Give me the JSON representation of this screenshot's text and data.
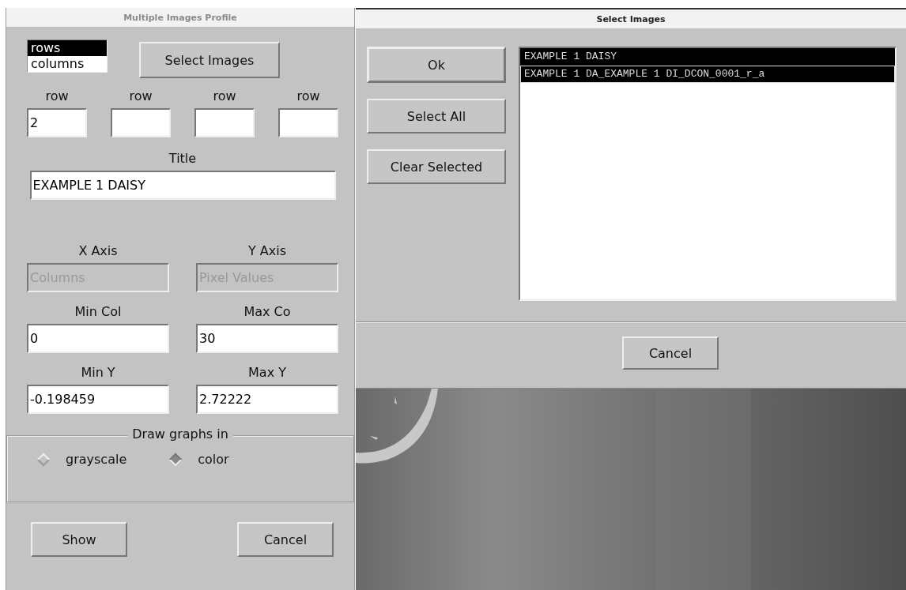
{
  "windows": [
    {
      "kind": "profile",
      "title": "Multiple Images Profile",
      "active": false,
      "orientation_list": [
        {
          "label": "rows",
          "selected": true
        },
        {
          "label": "columns",
          "selected": false
        }
      ],
      "select_button": "Select Images",
      "row_fields": [
        {
          "label": "row",
          "value": "2"
        },
        {
          "label": "row"
        },
        {
          "label": "row"
        },
        {
          "label": "row"
        }
      ],
      "title_field": {
        "label": "Title",
        "value": "EXAMPLE 1 DAISY"
      },
      "field_pairs": [
        [
          {
            "label": "X Axis",
            "value": "Columns",
            "disabled": true
          },
          {
            "label": "Y Axis",
            "value": "Pixel Values",
            "disabled": true
          }
        ],
        [
          {
            "label": "Min Col",
            "value": "0",
            "disabled": false
          },
          {
            "label": "Max Co",
            "value": "30",
            "disabled": false
          }
        ],
        [
          {
            "label": "Min Y",
            "value": "-0.198459",
            "disabled": false
          },
          {
            "label": "Max Y",
            "value": "2.72222",
            "disabled": false
          }
        ]
      ],
      "draw_group": {
        "legend": "Draw graphs in",
        "options": [
          {
            "label": "grayscale",
            "selected": false
          },
          {
            "label": "color",
            "selected": true
          }
        ]
      },
      "buttons": [
        "Show",
        "Cancel"
      ]
    },
    {
      "kind": "select",
      "title": "Select Images",
      "active": true,
      "side_buttons": [
        "Ok",
        "Select All",
        "Clear Selected"
      ],
      "images": [
        {
          "label": "EXAMPLE 1 DAISY",
          "selected": true,
          "focused": false
        },
        {
          "label": "EXAMPLE 1 DA_EXAMPLE 1 DI_DCON_0001_r_a",
          "selected": true,
          "focused": true
        }
      ],
      "buttons": [
        "Cancel"
      ]
    }
  ]
}
